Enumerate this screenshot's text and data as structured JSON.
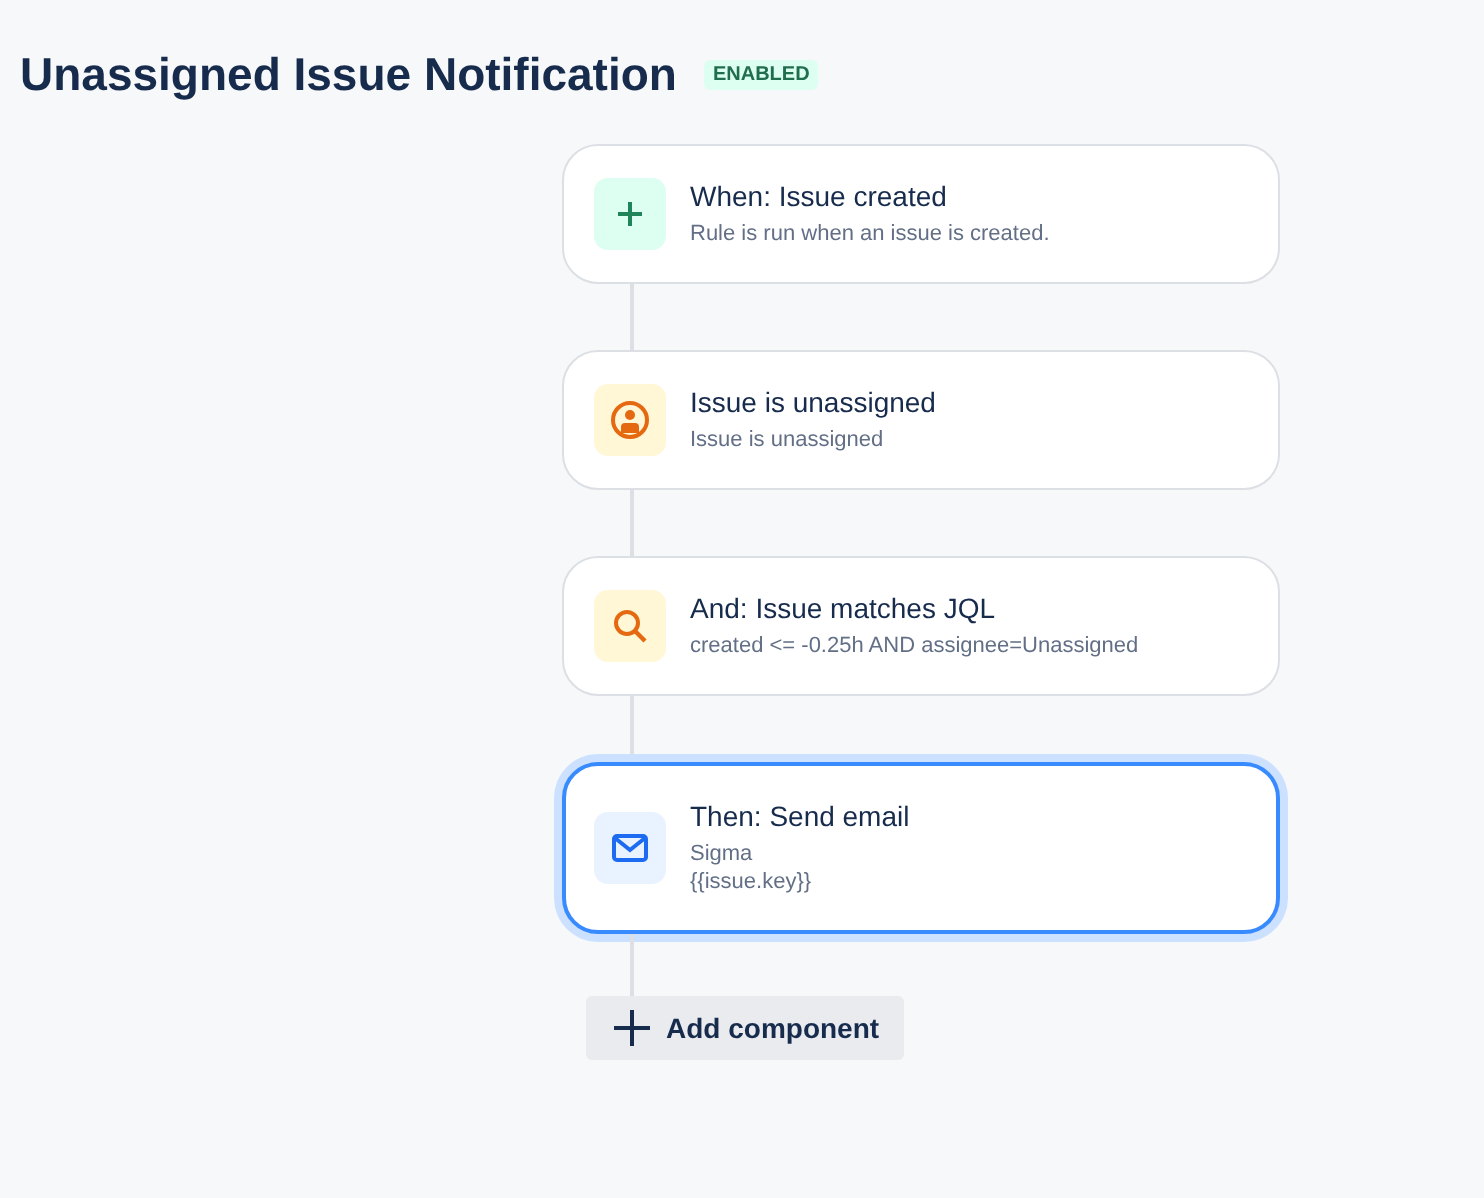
{
  "header": {
    "title": "Unassigned Issue Notification",
    "status": "ENABLED"
  },
  "components": [
    {
      "kind": "trigger",
      "title": "When: Issue created",
      "details": [
        "Rule is run when an issue is created."
      ],
      "selected": false
    },
    {
      "kind": "user",
      "title": "Issue is unassigned",
      "details": [
        "Issue is unassigned"
      ],
      "selected": false
    },
    {
      "kind": "search",
      "title": "And: Issue matches JQL",
      "details": [
        "created <= -0.25h AND assignee=Unassigned"
      ],
      "selected": false
    },
    {
      "kind": "email",
      "title": "Then: Send email",
      "details": [
        "Sigma",
        "{{issue.key}}"
      ],
      "selected": true
    }
  ],
  "add_button": {
    "label": "Add component"
  }
}
